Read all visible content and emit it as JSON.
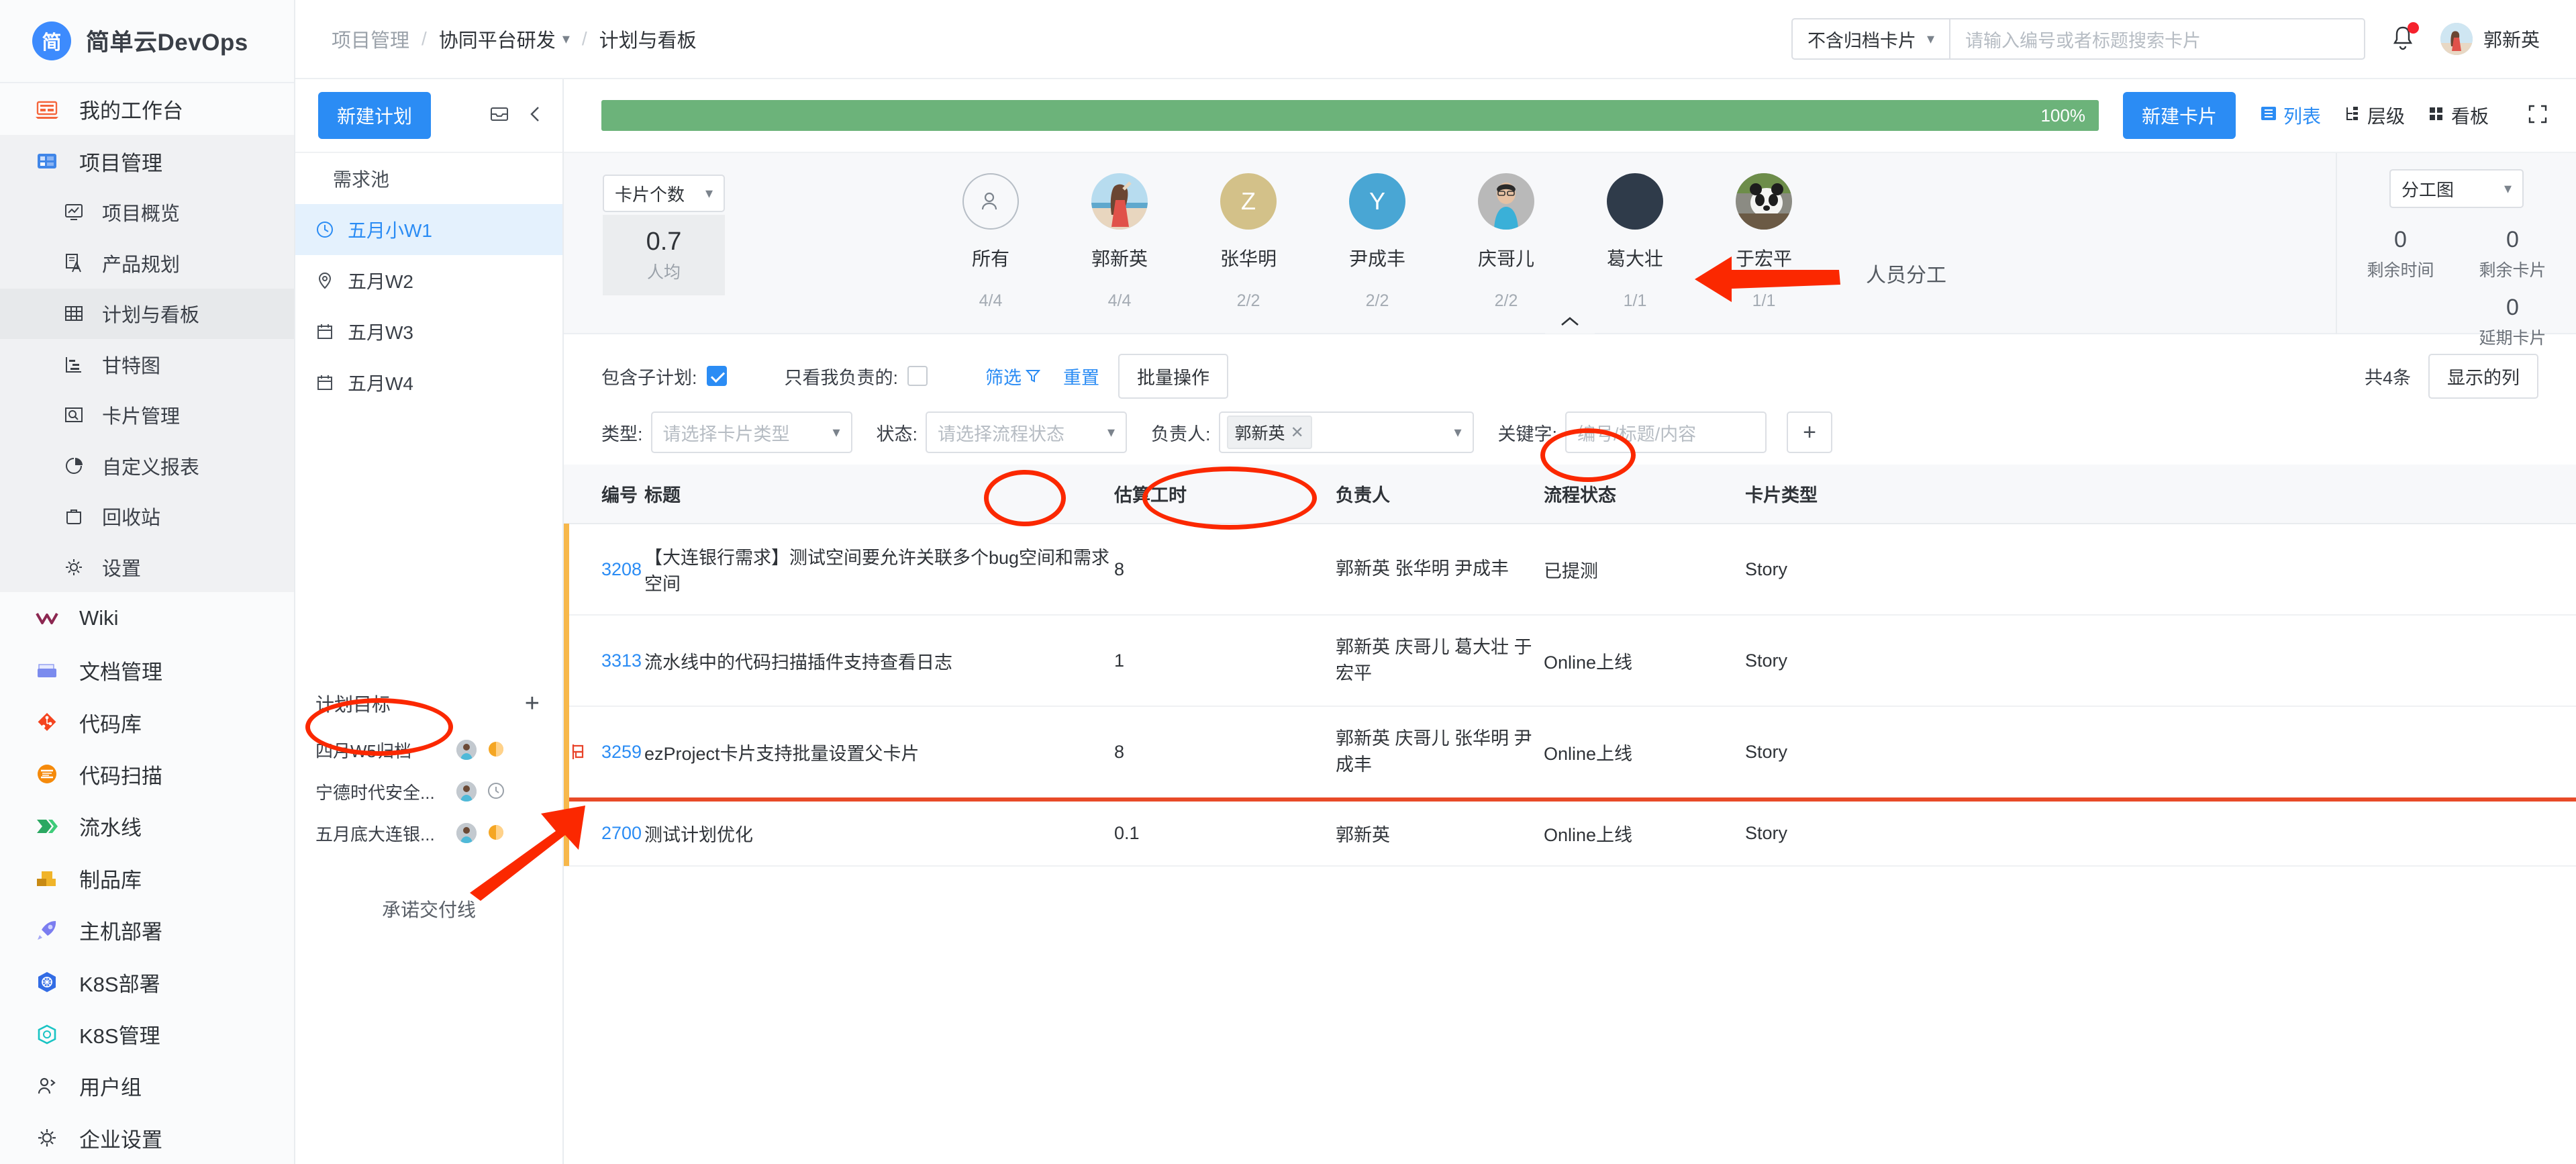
{
  "brand": {
    "logo_text": "简",
    "name": "简单云DevOps"
  },
  "nav": {
    "items": [
      {
        "label": "我的工作台",
        "icon": "workbench-icon"
      },
      {
        "label": "项目管理",
        "icon": "project-icon"
      }
    ],
    "project_sub": [
      {
        "label": "项目概览",
        "icon": "overview-icon"
      },
      {
        "label": "产品规划",
        "icon": "plan-icon"
      },
      {
        "label": "计划与看板",
        "icon": "board-icon"
      },
      {
        "label": "甘特图",
        "icon": "gantt-icon"
      },
      {
        "label": "卡片管理",
        "icon": "card-icon"
      },
      {
        "label": "自定义报表",
        "icon": "report-icon"
      },
      {
        "label": "回收站",
        "icon": "trash-icon"
      },
      {
        "label": "设置",
        "icon": "gear-icon"
      }
    ],
    "bottom": [
      {
        "label": "Wiki",
        "icon": "wiki-icon"
      },
      {
        "label": "文档管理",
        "icon": "docs-icon"
      },
      {
        "label": "代码库",
        "icon": "repo-icon"
      },
      {
        "label": "代码扫描",
        "icon": "scan-icon"
      },
      {
        "label": "流水线",
        "icon": "pipeline-icon"
      },
      {
        "label": "制品库",
        "icon": "artifact-icon"
      },
      {
        "label": "主机部署",
        "icon": "rocket-icon"
      },
      {
        "label": "K8S部署",
        "icon": "k8s-icon"
      },
      {
        "label": "K8S管理",
        "icon": "k8s-manage-icon"
      },
      {
        "label": "用户组",
        "icon": "usergroup-icon"
      },
      {
        "label": "企业设置",
        "icon": "enterprise-gear-icon"
      }
    ]
  },
  "topbar": {
    "breadcrumb": {
      "root": "项目管理",
      "project": "协同平台研发",
      "page": "计划与看板",
      "sep": "/"
    },
    "archive_filter": "不含归档卡片",
    "search_placeholder": "请输入编号或者标题搜索卡片",
    "user_name": "郭新英"
  },
  "plans": {
    "new_plan_button": "新建计划",
    "pool_label": "需求池",
    "items": [
      {
        "label": "五月小W1",
        "icon": "clock-icon",
        "active": true
      },
      {
        "label": "五月W2",
        "icon": "pin-icon",
        "active": false
      },
      {
        "label": "五月W3",
        "icon": "calendar-icon",
        "active": false
      },
      {
        "label": "五月W4",
        "icon": "calendar-icon",
        "active": false
      }
    ],
    "goals_title": "计划目标",
    "goals_add": "+",
    "goals": [
      {
        "name": "四月W5归档",
        "status": "pie-icon"
      },
      {
        "name": "宁德时代安全...",
        "status": "clock-icon"
      },
      {
        "name": "五月底大连银...",
        "status": "pie-icon"
      }
    ],
    "commit_line_label": "承诺交付线"
  },
  "toolbar": {
    "progress_pct": "100%",
    "progress_value": 100,
    "new_card_button": "新建卡片",
    "views": [
      {
        "label": "列表",
        "active": true,
        "icon": "list-icon"
      },
      {
        "label": "层级",
        "active": false,
        "icon": "hierarchy-icon"
      },
      {
        "label": "看板",
        "active": false,
        "icon": "kanban-icon"
      }
    ],
    "fullscreen_icon": "fullscreen-icon"
  },
  "workload": {
    "metric_select": "卡片个数",
    "average_value": "0.7",
    "average_label": "人均",
    "people": [
      {
        "name": "所有",
        "count": "4/4",
        "avatar_type": "ring",
        "initial": "",
        "color": "#f7f8fa"
      },
      {
        "name": "郭新英",
        "count": "4/4",
        "avatar_type": "photo-beach",
        "initial": "",
        "color": "#7fb6d8"
      },
      {
        "name": "张华明",
        "count": "2/2",
        "avatar_type": "initial",
        "initial": "Z",
        "color": "#d3c189"
      },
      {
        "name": "尹成丰",
        "count": "2/2",
        "avatar_type": "initial",
        "initial": "Y",
        "color": "#49a6d4"
      },
      {
        "name": "庆哥儿",
        "count": "2/2",
        "avatar_type": "photo-person",
        "initial": "",
        "color": "#b4b4b4"
      },
      {
        "name": "葛大壮",
        "count": "1/1",
        "avatar_type": "solid",
        "initial": "",
        "color": "#2f3b4a"
      },
      {
        "name": "于宏平",
        "count": "1/1",
        "avatar_type": "photo-panda",
        "initial": "",
        "color": "#8a8f95"
      }
    ],
    "collapse_icon": "chevron-up-icon"
  },
  "stats": {
    "chart_select": "分工图",
    "cells": [
      {
        "value": "0",
        "label": "剩余时间"
      },
      {
        "value": "0",
        "label": "剩余卡片"
      },
      {
        "value": "0",
        "label": "延期卡片"
      }
    ]
  },
  "filters": {
    "include_sub_label": "包含子计划:",
    "include_sub_checked": true,
    "only_mine_label": "只看我负责的:",
    "only_mine_checked": false,
    "filter_link": "筛选",
    "reset_link": "重置",
    "batch_button": "批量操作",
    "type_label": "类型:",
    "type_placeholder": "请选择卡片类型",
    "status_label": "状态:",
    "status_placeholder": "请选择流程状态",
    "owner_label": "负责人:",
    "owner_tag": "郭新英",
    "keyword_label": "关键字:",
    "keyword_placeholder": "编号/标题/内容",
    "add_button": "+",
    "total_text": "共4条",
    "columns_button": "显示的列"
  },
  "table": {
    "columns": [
      "编号",
      "标题",
      "估算工时",
      "负责人",
      "流程状态",
      "卡片类型"
    ],
    "rows": [
      {
        "id": "3208",
        "title": "【大连银行需求】测试空间要允许关联多个bug空间和需求空间",
        "hours": "8",
        "owners": "郭新英 张华明 尹成丰",
        "status": "已提测",
        "type": "Story",
        "flag": false,
        "redline_after": false
      },
      {
        "id": "3313",
        "title": "流水线中的代码扫描插件支持查看日志",
        "hours": "1",
        "owners": "郭新英 庆哥儿 葛大壮 于宏平",
        "status": "Online上线",
        "type": "Story",
        "flag": false,
        "redline_after": false
      },
      {
        "id": "3259",
        "title": "ezProject卡片支持批量设置父卡片",
        "hours": "8",
        "owners": "郭新英 庆哥儿 张华明 尹成丰",
        "status": "Online上线",
        "type": "Story",
        "flag": true,
        "redline_after": true
      },
      {
        "id": "2700",
        "title": "测试计划优化",
        "hours": "0.1",
        "owners": "郭新英",
        "status": "Online上线",
        "type": "Story",
        "flag": false,
        "redline_after": false
      }
    ]
  },
  "annotations": {
    "staffing_label": "人员分工",
    "accent_color": "#fb2800"
  }
}
